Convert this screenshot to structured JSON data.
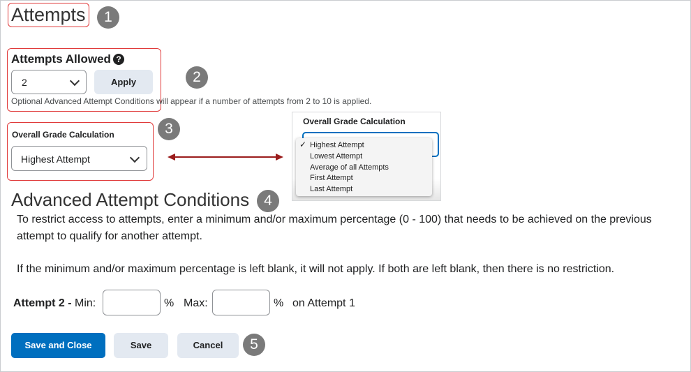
{
  "attempts_section": {
    "title": "Attempts",
    "badge": "1"
  },
  "attempts_allowed": {
    "label": "Attempts Allowed",
    "help_icon": "question-circle-icon",
    "selected_value": "2",
    "apply_label": "Apply",
    "note": "Optional Advanced Attempt Conditions will appear if a number of attempts from 2 to 10 is applied.",
    "badge": "2"
  },
  "grade_calc": {
    "label": "Overall Grade Calculation",
    "selected_value": "Highest Attempt",
    "badge": "3",
    "arrow_color": "#9b1c1c"
  },
  "dropdown_preview": {
    "label": "Overall Grade Calculation",
    "check_mark": "✓",
    "options": [
      "Highest Attempt",
      "Lowest Attempt",
      "Average of all Attempts",
      "First Attempt",
      "Last Attempt"
    ],
    "selected_index": 0
  },
  "advanced": {
    "title": "Advanced Attempt Conditions",
    "badge": "4",
    "para1": "To restrict access to attempts, enter a minimum and/or maximum percentage (0 - 100) that needs to be achieved on the previous attempt to qualify for another attempt.",
    "para2": "If the minimum and/or maximum percentage is left blank, it will not apply. If both are left blank, then there is no restriction.",
    "attempt_label": "Attempt 2 -",
    "min_label": "Min:",
    "min_value": "",
    "percent1": "%",
    "max_label": "Max:",
    "max_value": "",
    "percent2": "%",
    "on_attempt": "on Attempt 1"
  },
  "footer": {
    "save_close_label": "Save and Close",
    "save_label": "Save",
    "cancel_label": "Cancel",
    "badge": "5"
  },
  "colors": {
    "primary": "#006fbf",
    "highlight_box": "#e03a3a",
    "badge": "#7a7a7a"
  }
}
